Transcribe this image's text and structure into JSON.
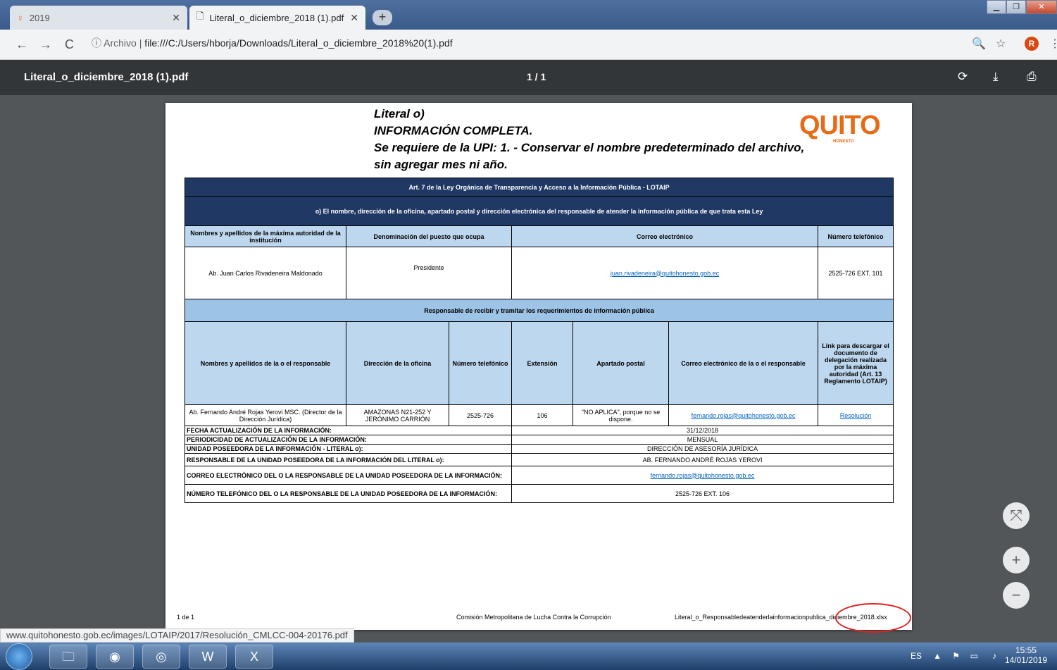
{
  "browser": {
    "tabs": [
      {
        "label": "2019",
        "icon": "user-icon"
      },
      {
        "label": "Literal_o_diciembre_2018 (1).pdf",
        "icon": "document-icon"
      }
    ],
    "new_tab": "+",
    "address": {
      "security_label": "Archivo",
      "url": "file:///C:/Users/hborja/Downloads/Literal_o_diciembre_2018%20(1).pdf"
    },
    "avatar": "R"
  },
  "viewer": {
    "title": "Literal_o_diciembre_2018 (1).pdf",
    "pages": "1 / 1"
  },
  "document": {
    "heading": [
      "Literal o)",
      "INFORMACIÓN COMPLETA.",
      "Se requiere de la UPI: 1. - Conservar el nombre predeterminado del archivo,",
      "sin agregar mes ni año."
    ],
    "logo": {
      "name": "QUITO",
      "tagline": "HONESTO"
    },
    "table": {
      "title": "Art. 7 de la Ley Orgánica de Transparencia y Acceso a la Información Pública - LOTAIP",
      "subtitle": "o) El nombre, dirección de la oficina, apartado postal y dirección electrónica del responsable de atender la información pública de que trata esta Ley",
      "authority_headers": [
        "Nombres y apellidos de la máxima autoridad de la institución",
        "Denominación del puesto que ocupa",
        "Correo electrónico",
        "Número telefónico"
      ],
      "authority_row": [
        "Ab. Juan Carlos Rivadeneira Maldonado",
        "Presidente",
        "juan.rivadeneira@quitohonesto.gob.ec",
        "2525-726 EXT. 101"
      ],
      "responsible_title": "Responsable de recibir y tramitar los requerimientos de información pública",
      "responsible_headers": [
        "Nombres y apellidos de la o el responsable",
        "Dirección de la oficina",
        "Número telefónico",
        "Extensión",
        "Apartado postal",
        "Correo electrónico de la o el responsable",
        "Link para descargar el documento de delegación realizada por la máxima autoridad (Art. 13 Reglamento LOTAIP)"
      ],
      "responsible_row": [
        "Ab. Fernando André Rojas Yerovi MSC. (Director de la Dirección Jurídica)",
        "AMAZONAS N21-252 Y JERÓNIMO CARRIÓN",
        "2525-726",
        "106",
        "\"NO APLICA\", porque no se dispone.",
        "fernando.rojas@quitohonesto.gob.ec",
        "Resolución"
      ],
      "info_rows": [
        {
          "label": "FECHA ACTUALIZACIÓN DE LA INFORMACIÓN:",
          "value": "31/12/2018"
        },
        {
          "label": "PERIODICIDAD DE ACTUALIZACIÓN DE LA INFORMACIÓN:",
          "value": "MENSUAL"
        },
        {
          "label": "UNIDAD POSEEDORA DE LA INFORMACIÓN - LITERAL o):",
          "value": "DIRECCIÓN DE ASESORÍA JURÍDICA"
        },
        {
          "label": "RESPONSABLE DE LA UNIDAD POSEEDORA DE LA INFORMACIÓN DEL LITERAL o):",
          "value": "AB. FERNANDO ANDRÉ ROJAS YEROVI"
        },
        {
          "label": "CORREO ELECTRÓNICO DEL O LA RESPONSABLE DE LA UNIDAD POSEEDORA DE LA INFORMACIÓN:",
          "value": "fernando.rojas@quitohonesto.gob.ec"
        },
        {
          "label": "NÚMERO TELEFÓNICO DEL O LA RESPONSABLE DE LA UNIDAD POSEEDORA DE LA INFORMACIÓN:",
          "value": "2525-726 EXT. 106"
        }
      ]
    },
    "footer": {
      "page": "1 de 1",
      "org": "Comisión Metropolitana de Lucha Contra la Corrupción",
      "file": "Literal_o_Responsabledeatenderlainformacionpublica_diciembre_2018.xlsx"
    }
  },
  "status_url": "www.quitohonesto.gob.ec/images/LOTAIP/2017/Resolución_CMLCC-004-20176.pdf",
  "tray": {
    "lang": "ES",
    "time": "15:55",
    "date": "14/01/2019"
  }
}
